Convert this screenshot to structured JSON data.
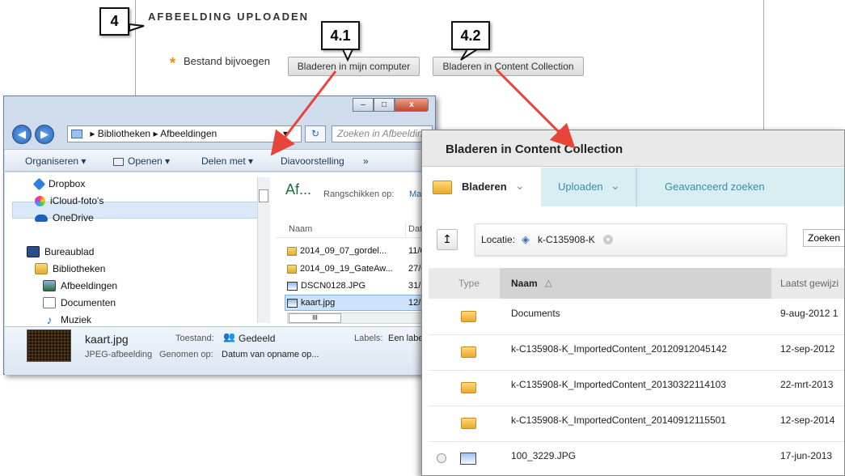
{
  "upload": {
    "title": "AFBEELDING UPLOADEN",
    "required_mark": "*",
    "attach_label": "Bestand bijvoegen",
    "browse_computer_button": "Bladeren in mijn computer",
    "browse_collection_button": "Bladeren in Content Collection"
  },
  "callouts": {
    "step": "4",
    "step_1": "4.1",
    "step_2": "4.2"
  },
  "explorer": {
    "window_buttons": {
      "minimize": "–",
      "maximize": "□",
      "close": "x"
    },
    "breadcrumb": [
      "Bibliotheken",
      "Afbeeldingen"
    ],
    "search_placeholder": "Zoeken in Afbeeldingen",
    "toolbar": [
      "Organiseren",
      "Openen",
      "Delen met",
      "Diavoorstelling",
      "»"
    ],
    "nav_items": [
      {
        "label": "Dropbox",
        "icon": "dropbox-icon"
      },
      {
        "label": "iCloud-foto's",
        "icon": "icloud-photos-icon"
      },
      {
        "label": "OneDrive",
        "icon": "onedrive-icon"
      },
      {
        "label": "Bureaublad",
        "icon": "desktop-icon"
      },
      {
        "label": "Bibliotheken",
        "icon": "libraries-icon"
      },
      {
        "label": "Afbeeldingen",
        "icon": "pictures-icon"
      },
      {
        "label": "Documenten",
        "icon": "documents-icon"
      },
      {
        "label": "Muziek",
        "icon": "music-icon"
      }
    ],
    "pane_title": "Af...",
    "arrange_label": "Rangschikken op:",
    "arrange_value": "Ma",
    "columns": [
      "Naam",
      "Dat"
    ],
    "files": [
      {
        "name": "2014_09_07_gordel...",
        "date": "11/0",
        "type": "folder"
      },
      {
        "name": "2014_09_19_GateAw...",
        "date": "27/0",
        "type": "folder"
      },
      {
        "name": "DSCN0128.JPG",
        "date": "31/1",
        "type": "image"
      },
      {
        "name": "kaart.jpg",
        "date": "12/1",
        "type": "image"
      }
    ],
    "scroll_grip": "III",
    "details": {
      "filename": "kaart.jpg",
      "filetype": "JPEG-afbeelding",
      "state_label": "Toestand:",
      "state_value": "Gedeeld",
      "taken_label": "Genomen op:",
      "taken_value": "Datum van opname op...",
      "labels_label": "Labels:",
      "labels_value": "Een labe"
    }
  },
  "collection": {
    "title": "Bladeren in Content Collection",
    "tabs": [
      "Bladeren",
      "Uploaden",
      "Geavanceerd zoeken"
    ],
    "location_label": "Locatie:",
    "location_value": "k-C135908-K",
    "search_button": "Zoeken",
    "columns": {
      "type": "Type",
      "name": "Naam",
      "modified": "Laatst gewijzi"
    },
    "rows": [
      {
        "name": "Documents",
        "date": "9-aug-2012 1",
        "type": "folder"
      },
      {
        "name": "k-C135908-K_ImportedContent_20120912045142",
        "date": "12-sep-2012",
        "type": "folder"
      },
      {
        "name": "k-C135908-K_ImportedContent_20130322114103",
        "date": "22-mrt-2013",
        "type": "folder"
      },
      {
        "name": "k-C135908-K_ImportedContent_20140912115501",
        "date": "12-sep-2014",
        "type": "folder"
      },
      {
        "name": "100_3229.JPG",
        "date": "17-jun-2013",
        "type": "image"
      }
    ]
  },
  "colors": {
    "accent_arrow": "#e8443a",
    "teal_tab": "#d9eef2",
    "tab_text": "#3a8fa3",
    "star": "#f08a00"
  }
}
